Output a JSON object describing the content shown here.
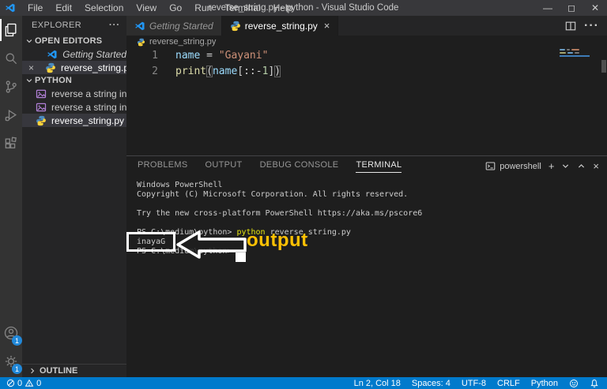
{
  "colors": {
    "accent": "#007ACC",
    "annotation_yellow": "#FFC104",
    "string_orange": "#CE9178",
    "variable_blue": "#9CDCFE",
    "function_yellow": "#DCDCAA",
    "terminal_command_yellow": "#E5E510",
    "selection_row": "#37373D"
  },
  "title_bar": {
    "menus": [
      "File",
      "Edit",
      "Selection",
      "View",
      "Go",
      "Run",
      "Terminal",
      "Help"
    ],
    "title": "reverse_string.py - python - Visual Studio Code",
    "window_controls": {
      "minimize": "—",
      "maximize": "◻",
      "close": "✕"
    }
  },
  "activity_bar": {
    "icons": [
      "explorer-icon",
      "search-icon",
      "source-control-icon",
      "run-debug-icon",
      "extensions-icon",
      "account-icon",
      "settings-gear-icon"
    ],
    "account_badge": "1",
    "settings_badge": "1"
  },
  "sidebar": {
    "title": "EXPLORER",
    "more_actions": "···",
    "open_editors": {
      "label": "OPEN EDITORS",
      "items": [
        {
          "label": "Getting Started",
          "icon": "vscode-icon",
          "close": "×"
        },
        {
          "label": "reverse_string.py",
          "icon": "python-icon",
          "close": "×"
        }
      ]
    },
    "folder": {
      "label": "PYTHON",
      "items": [
        {
          "label": "reverse a string in pyt...",
          "icon": "image-icon"
        },
        {
          "label": "reverse a string in pyt...",
          "icon": "image-icon"
        },
        {
          "label": "reverse_string.py",
          "icon": "python-icon"
        }
      ]
    },
    "outline": {
      "label": "OUTLINE"
    }
  },
  "editor": {
    "tabs": [
      {
        "label": "Getting Started",
        "active": false
      },
      {
        "label": "reverse_string.py",
        "active": true,
        "close": "×"
      }
    ],
    "breadcrumb": "reverse_string.py",
    "code_lines": [
      {
        "num": "1",
        "tokens": [
          {
            "text": "name",
            "cls": "variable"
          },
          {
            "text": " = ",
            "cls": "plain"
          },
          {
            "text": "\"Gayani\"",
            "cls": "string"
          }
        ]
      },
      {
        "num": "2",
        "tokens": [
          {
            "text": "print",
            "cls": "function"
          },
          {
            "text": "(",
            "cls": "bracket"
          },
          {
            "text": "name",
            "cls": "variable"
          },
          {
            "text": "[::",
            "cls": "plain"
          },
          {
            "text": "-",
            "cls": "plain"
          },
          {
            "text": "1",
            "cls": "number"
          },
          {
            "text": "]",
            "cls": "plain"
          },
          {
            "text": ")",
            "cls": "bracket"
          }
        ]
      }
    ]
  },
  "panel": {
    "tabs": [
      {
        "label": "PROBLEMS",
        "active": false
      },
      {
        "label": "OUTPUT",
        "active": false
      },
      {
        "label": "DEBUG CONSOLE",
        "active": false
      },
      {
        "label": "TERMINAL",
        "active": true
      }
    ],
    "shell_label": "powershell",
    "terminal_lines": [
      {
        "tokens": [
          {
            "text": "Windows PowerShell",
            "cls": "term"
          }
        ]
      },
      {
        "tokens": [
          {
            "text": "Copyright (C) Microsoft Corporation. All rights reserved.",
            "cls": "term"
          }
        ]
      },
      {
        "tokens": []
      },
      {
        "tokens": [
          {
            "text": "Try the new cross-platform PowerShell https://aka.ms/pscore6",
            "cls": "term"
          }
        ]
      },
      {
        "tokens": []
      },
      {
        "tokens": [
          {
            "text": "PS C:\\medium\\python> ",
            "cls": "term"
          },
          {
            "text": "python",
            "cls": "cmd"
          },
          {
            "text": " reverse_string.py",
            "cls": "term"
          }
        ]
      },
      {
        "tokens": [
          {
            "text": "inayaG",
            "cls": "term"
          }
        ]
      },
      {
        "tokens": [
          {
            "text": "PS C:\\medium\\python>",
            "cls": "term"
          }
        ]
      }
    ]
  },
  "annotation": {
    "boxed_text": "inayaG",
    "label": "output"
  },
  "status_bar": {
    "errors": "0",
    "warnings": "0",
    "cursor": "Ln 2, Col 18",
    "indent": "Spaces: 4",
    "encoding": "UTF-8",
    "eol": "CRLF",
    "language": "Python"
  }
}
